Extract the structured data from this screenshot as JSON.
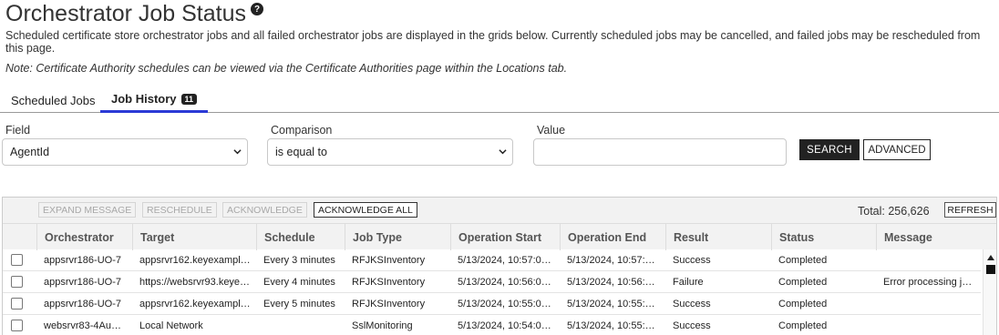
{
  "page": {
    "title": "Orchestrator Job Status",
    "description": "Scheduled certificate store orchestrator jobs and all failed orchestrator jobs are displayed in the grids below. Currently scheduled jobs may be cancelled, and failed jobs may be rescheduled from this page.",
    "note": "Note: Certificate Authority schedules can be viewed via the Certificate Authorities page within the Locations tab."
  },
  "tabs": [
    {
      "label": "Scheduled Jobs",
      "active": false
    },
    {
      "label": "Job History",
      "badge": "11",
      "active": true
    }
  ],
  "filter": {
    "field_label": "Field",
    "field_value": "AgentId",
    "comparison_label": "Comparison",
    "comparison_value": "is equal to",
    "value_label": "Value",
    "value_text": "",
    "search_label": "SEARCH",
    "advanced_label": "ADVANCED"
  },
  "toolbar": {
    "expand_message": "EXPAND MESSAGE",
    "reschedule": "RESCHEDULE",
    "acknowledge": "ACKNOWLEDGE",
    "acknowledge_all": "ACKNOWLEDGE ALL",
    "total": "Total: 256,626",
    "refresh": "REFRESH"
  },
  "grid": {
    "columns": [
      "Orchestrator",
      "Target",
      "Schedule",
      "Job Type",
      "Operation Start",
      "Operation End",
      "Result",
      "Status",
      "Message"
    ],
    "rows": [
      [
        "appsrvr186-UO-7",
        "appsrvr162.keyexampl…",
        "Every 3 minutes",
        "RFJKSInventory",
        "5/13/2024, 10:57:0…",
        "5/13/2024, 10:57:…",
        "Success",
        "Completed",
        ""
      ],
      [
        "appsrvr186-UO-7",
        "https://websrvr93.keye…",
        "Every 4 minutes",
        "RFJKSInventory",
        "5/13/2024, 10:56:0…",
        "5/13/2024, 10:56:…",
        "Failure",
        "Completed",
        "Error processing j…"
      ],
      [
        "appsrvr186-UO-7",
        "appsrvr162.keyexampl…",
        "Every 5 minutes",
        "RFJKSInventory",
        "5/13/2024, 10:55:0…",
        "5/13/2024, 10:55:…",
        "Success",
        "Completed",
        ""
      ],
      [
        "websrvr83-4Au…",
        "Local Network",
        "",
        "SslMonitoring",
        "5/13/2024, 10:54:0…",
        "5/13/2024, 10:55:…",
        "Success",
        "Completed",
        ""
      ]
    ]
  },
  "icons": {
    "help": "question-circle-icon",
    "chevron": "chevron-down-icon"
  },
  "colors": {
    "accent": "#2b3ad6",
    "primary_button": "#222222"
  }
}
